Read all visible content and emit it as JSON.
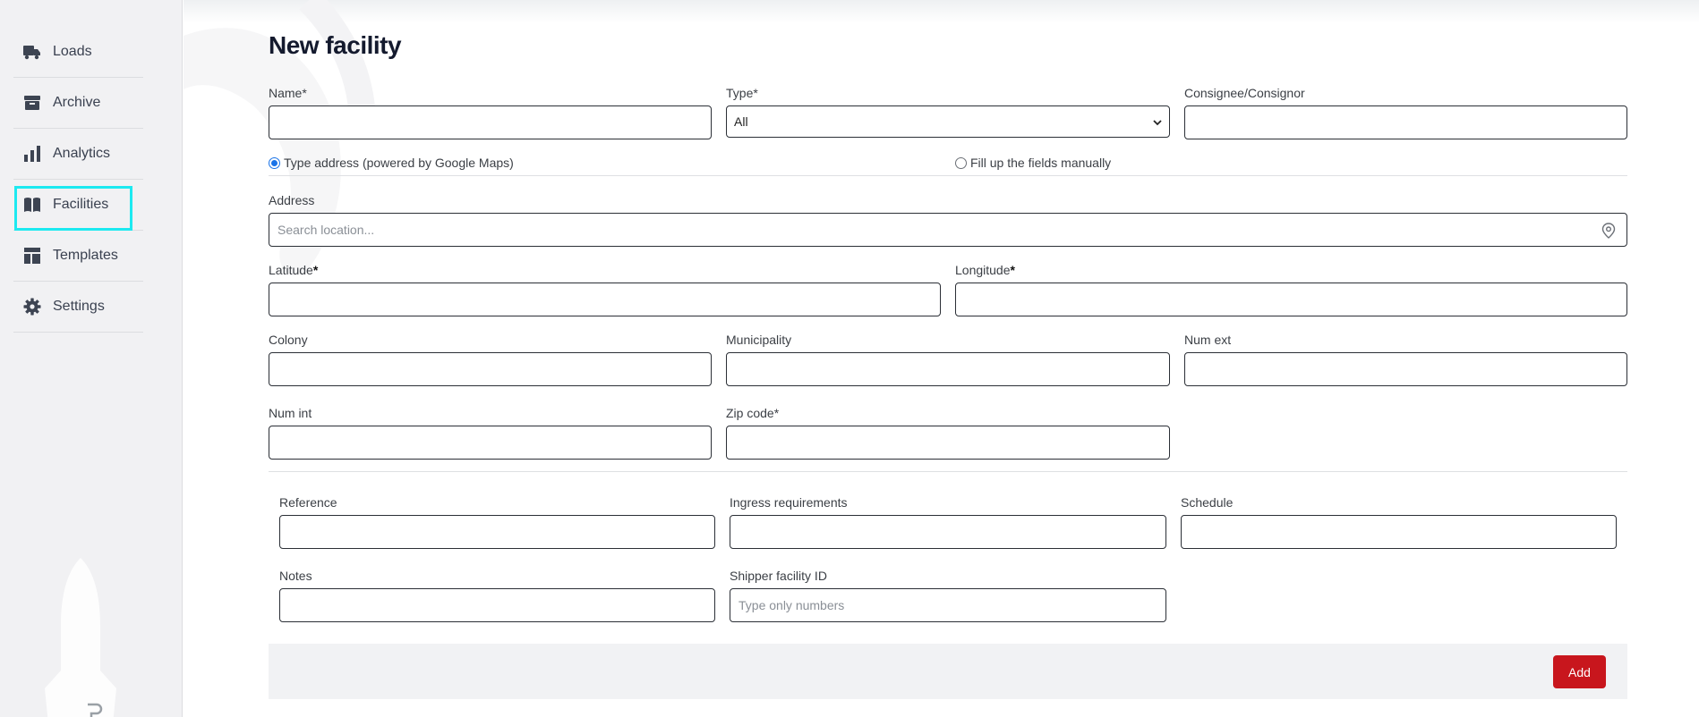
{
  "sidebar": {
    "items": [
      {
        "label": "Loads",
        "icon": "truck-icon"
      },
      {
        "label": "Archive",
        "icon": "archive-icon"
      },
      {
        "label": "Analytics",
        "icon": "bar-chart-icon"
      },
      {
        "label": "Facilities",
        "icon": "book-icon",
        "active": true
      },
      {
        "label": "Templates",
        "icon": "template-icon"
      },
      {
        "label": "Settings",
        "icon": "gear-icon"
      }
    ],
    "highlight_color": "#1de9f0"
  },
  "page": {
    "title": "New facility"
  },
  "form": {
    "name_label": "Name*",
    "type_label": "Type*",
    "type_value": "All",
    "consignee_label": "Consignee/Consignor",
    "radio_google_label": "Type address (powered by Google Maps)",
    "radio_manual_label": "Fill up the fields manually",
    "address_label": "Address",
    "address_placeholder": "Search location...",
    "latitude_label": "Latitude",
    "longitude_label": "Longitude",
    "required_mark": "*",
    "colony_label": "Colony",
    "municipality_label": "Municipality",
    "num_ext_label": "Num ext",
    "num_int_label": "Num int",
    "zip_label": "Zip code*",
    "reference_label": "Reference",
    "ingress_label": "Ingress requirements",
    "schedule_label": "Schedule",
    "notes_label": "Notes",
    "shipper_id_label": "Shipper facility ID",
    "shipper_id_placeholder": "Type only numbers",
    "add_label": "Add"
  },
  "colors": {
    "accent_red": "#c8161d",
    "radio_blue": "#1a73e8",
    "sidebar_bg": "#f1f1f3"
  }
}
